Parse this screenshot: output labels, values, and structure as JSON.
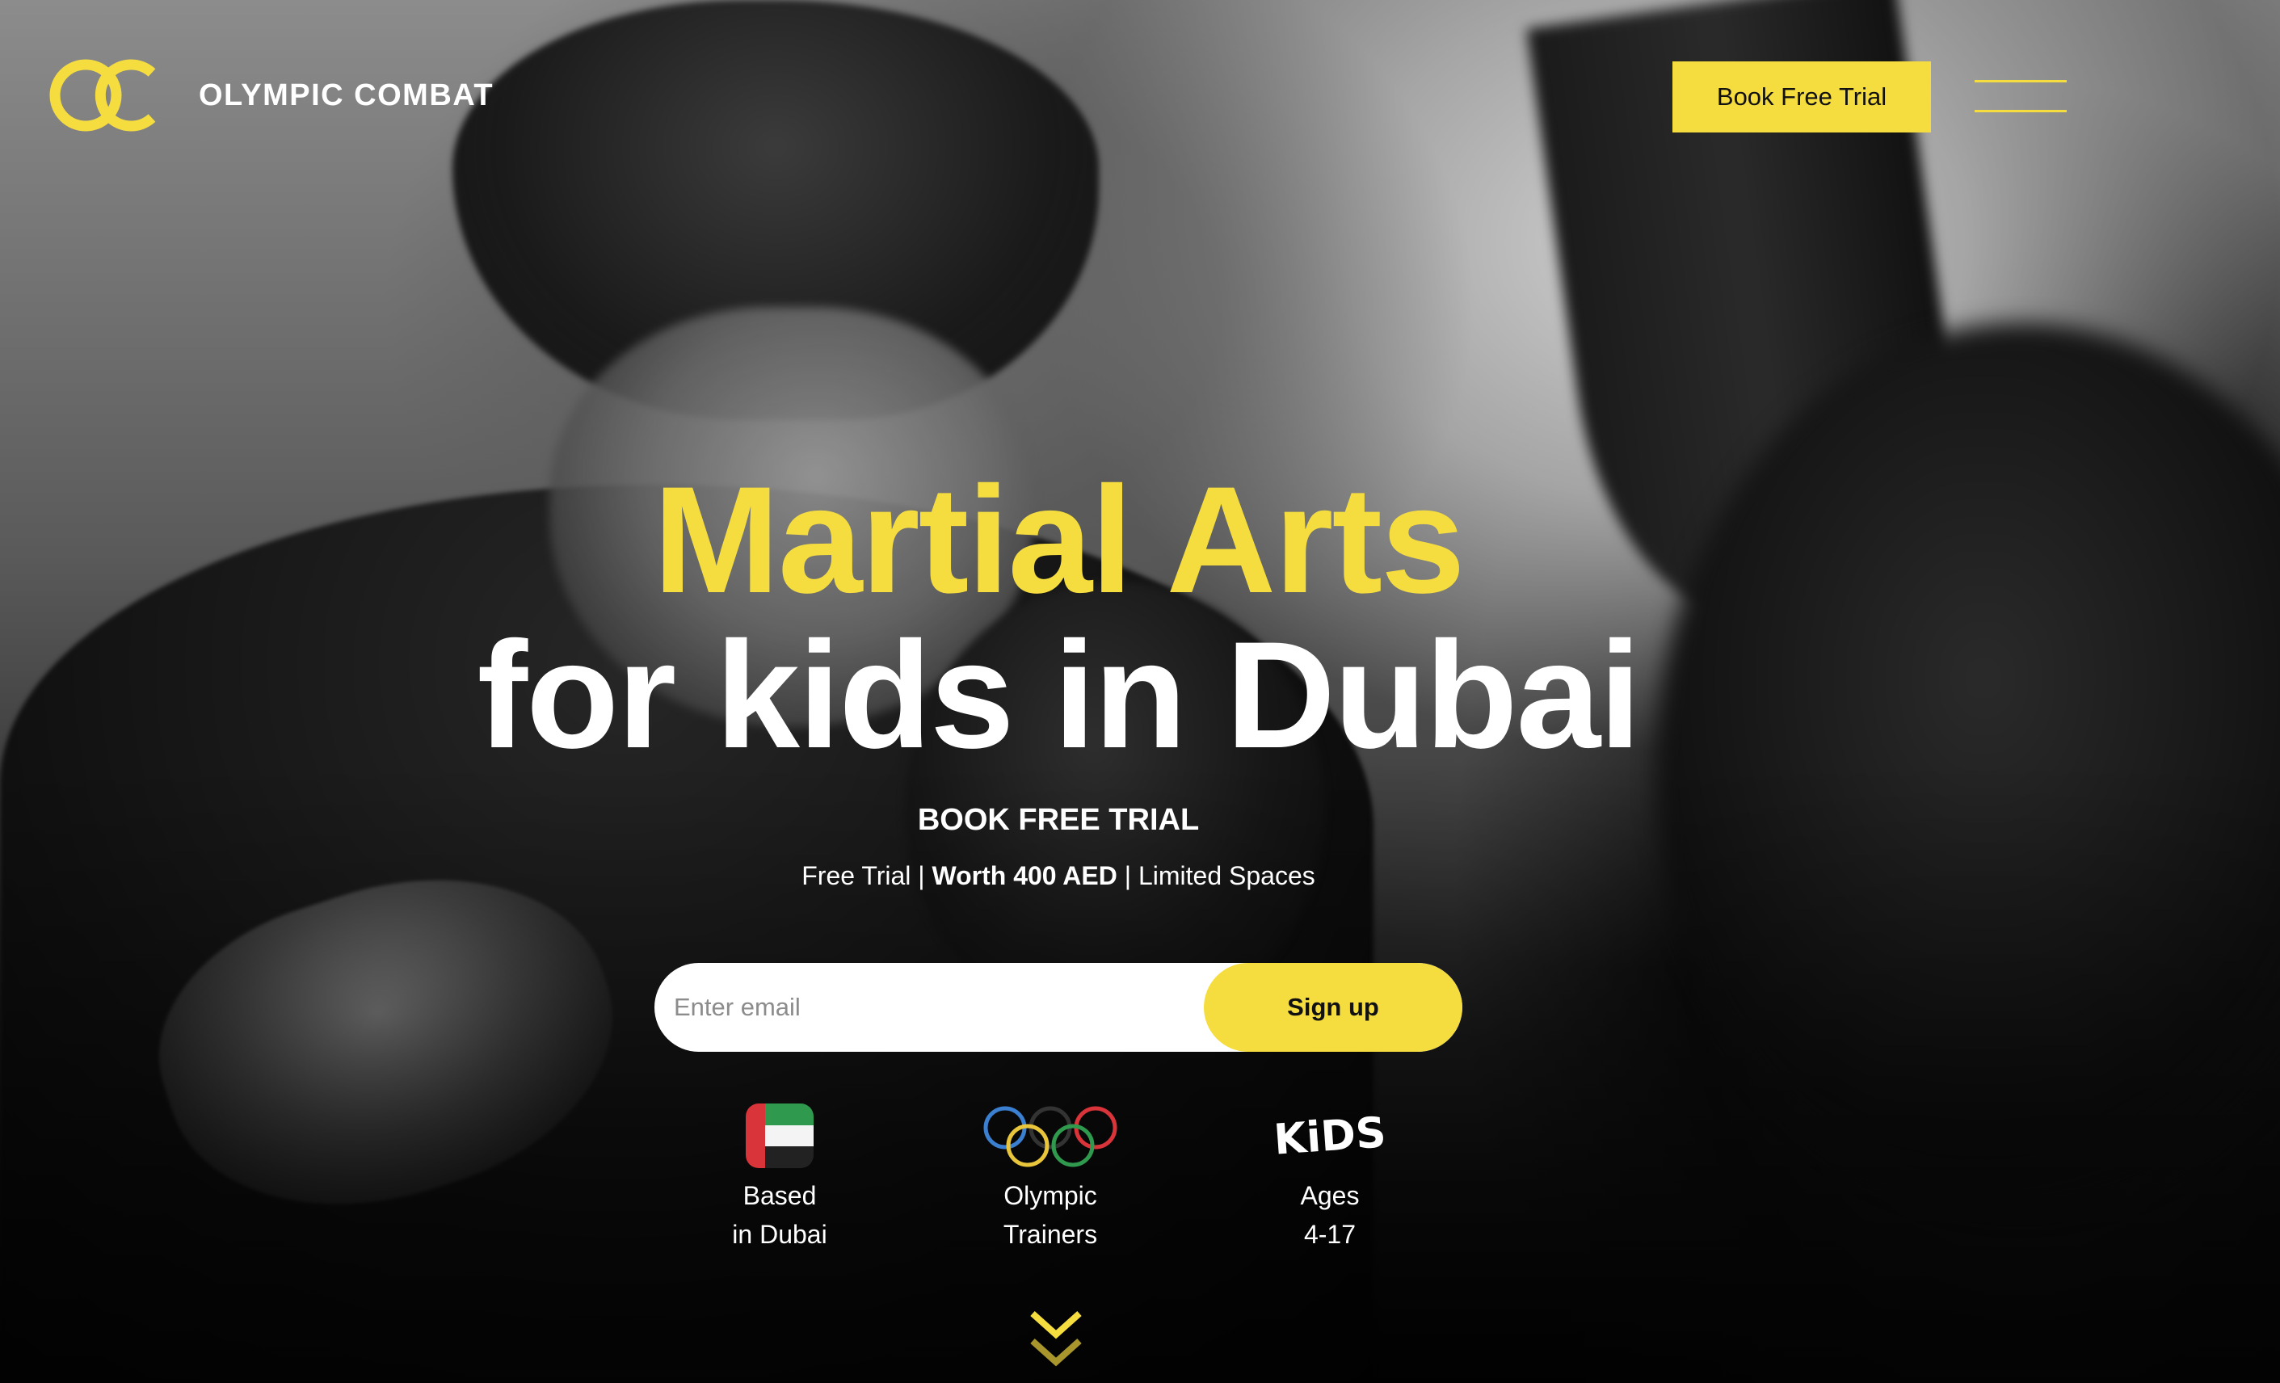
{
  "header": {
    "brand_name": "OLYMPIC COMBAT",
    "logo_icon": "oc-rings-logo",
    "cta_label": "Book Free Trial",
    "menu_icon": "hamburger-menu-icon"
  },
  "hero": {
    "title_line1": "Martial Arts",
    "title_line2": "for kids in Dubai",
    "subtitle": "BOOK FREE TRIAL",
    "offer_prefix": "Free Trial | ",
    "offer_bold": "Worth 400 AED",
    "offer_suffix": " | Limited Spaces"
  },
  "signup": {
    "email_placeholder": "Enter email",
    "email_value": "",
    "button_label": "Sign up"
  },
  "features": [
    {
      "icon": "uae-flag-icon",
      "line1": "Based",
      "line2": "in Dubai"
    },
    {
      "icon": "olympic-rings-icon",
      "line1": "Olympic",
      "line2": "Trainers"
    },
    {
      "icon": "kids-icon",
      "line1": "Ages",
      "line2": "4-17",
      "icon_text": "KiDS"
    }
  ],
  "scroll_icon": "double-chevron-down-icon",
  "colors": {
    "accent": "#f6dd3f",
    "text": "#ffffff",
    "button_text": "#111111"
  }
}
